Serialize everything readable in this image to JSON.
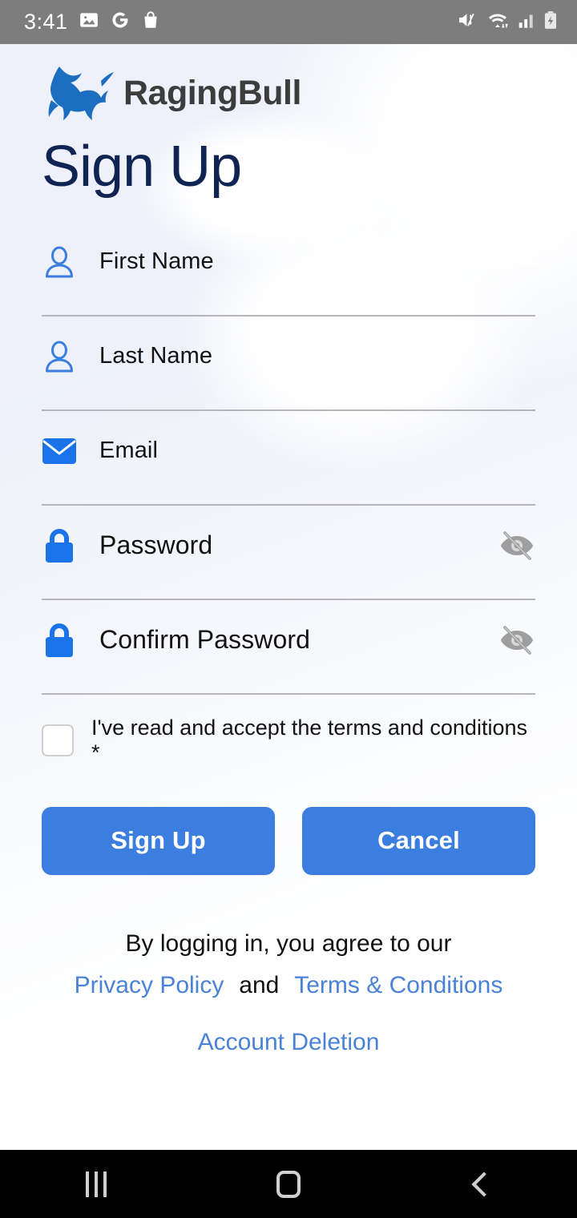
{
  "status_bar": {
    "time": "3:41",
    "left_icons": [
      "photos-icon",
      "google-icon",
      "shopping-bag-icon"
    ],
    "right_icons": [
      "mute-vibrate-icon",
      "wifi-icon",
      "cellular-signal-icon",
      "battery-charging-icon"
    ],
    "background_color": "#7d7d7d"
  },
  "brand": {
    "logo_icon": "bull-logo-icon",
    "name": "RagingBull",
    "name_color": "#3d3d3d",
    "logo_color": "#1c6fc0"
  },
  "page": {
    "title": "Sign Up",
    "title_color": "#0f2452",
    "accent_color": "#3b7ee0"
  },
  "form": {
    "fields": [
      {
        "name": "first-name",
        "icon": "person-icon",
        "placeholder": "First Name",
        "value": "",
        "has_toggle": false
      },
      {
        "name": "last-name",
        "icon": "person-icon",
        "placeholder": "Last Name",
        "value": "",
        "has_toggle": false
      },
      {
        "name": "email",
        "icon": "envelope-icon",
        "placeholder": "Email",
        "value": "",
        "has_toggle": false
      },
      {
        "name": "password",
        "icon": "lock-icon",
        "placeholder": "Password",
        "value": "",
        "has_toggle": true,
        "toggle_icon": "eye-off-icon"
      },
      {
        "name": "confirm-password",
        "icon": "lock-icon",
        "placeholder": "Confirm Password",
        "value": "",
        "has_toggle": true,
        "toggle_icon": "eye-off-icon"
      }
    ],
    "terms": {
      "checked": false,
      "label": "I've read and accept the terms and conditions *"
    },
    "buttons": {
      "submit_label": "Sign Up",
      "cancel_label": "Cancel"
    }
  },
  "footer": {
    "agree_text": "By logging in, you agree to our",
    "privacy_link": "Privacy Policy",
    "and_text": "and",
    "terms_link": "Terms & Conditions",
    "account_deletion_link": "Account Deletion",
    "link_color": "#4a82d8"
  },
  "nav_bar": {
    "recents_label": "recents-button",
    "home_label": "home-button",
    "back_label": "back-button"
  }
}
